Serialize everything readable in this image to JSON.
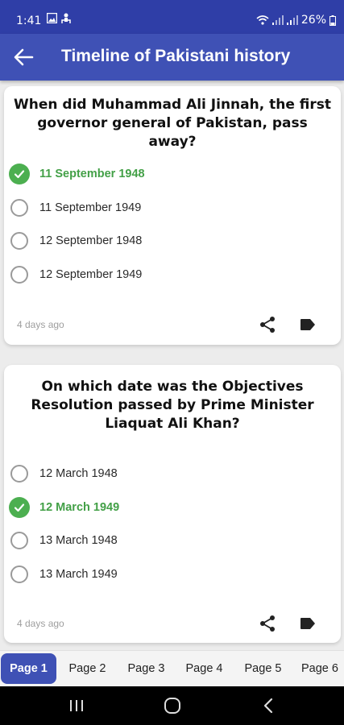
{
  "status_bar": {
    "time": "1:41",
    "battery": "26%",
    "icons": [
      "image-icon",
      "download-icon",
      "wifi-icon",
      "signal-icon",
      "signal-icon",
      "battery-icon"
    ]
  },
  "app_bar": {
    "title": "Timeline of Pakistani history",
    "back_icon": "arrow-back-icon"
  },
  "colors": {
    "status_bar": "#2f3ea7",
    "app_bar": "#3f51b5",
    "correct": "#4caf50",
    "active_page": "#3f51b5"
  },
  "questions": [
    {
      "question": "When did Muhammad Ali Jinnah, the first governor general of Pakistan, pass away?",
      "options": [
        {
          "label": "11 September 1948",
          "correct": true
        },
        {
          "label": "11 September 1949",
          "correct": false
        },
        {
          "label": "12 September 1948",
          "correct": false
        },
        {
          "label": "12 September 1949",
          "correct": false
        }
      ],
      "timestamp": "4 days ago"
    },
    {
      "question": "On which date was the Objectives Resolution passed by Prime Minister Liaquat Ali Khan?",
      "options": [
        {
          "label": "12 March 1948",
          "correct": false
        },
        {
          "label": "12 March 1949",
          "correct": true
        },
        {
          "label": "13 March 1948",
          "correct": false
        },
        {
          "label": "13 March 1949",
          "correct": false
        }
      ],
      "timestamp": "4 days ago"
    }
  ],
  "pagination": {
    "pages": [
      "Page 1",
      "Page 2",
      "Page 3",
      "Page 4",
      "Page 5",
      "Page 6"
    ],
    "active": "Page 1"
  },
  "nav_bar": {
    "buttons": [
      "recent-apps-icon",
      "home-icon",
      "back-icon"
    ]
  }
}
